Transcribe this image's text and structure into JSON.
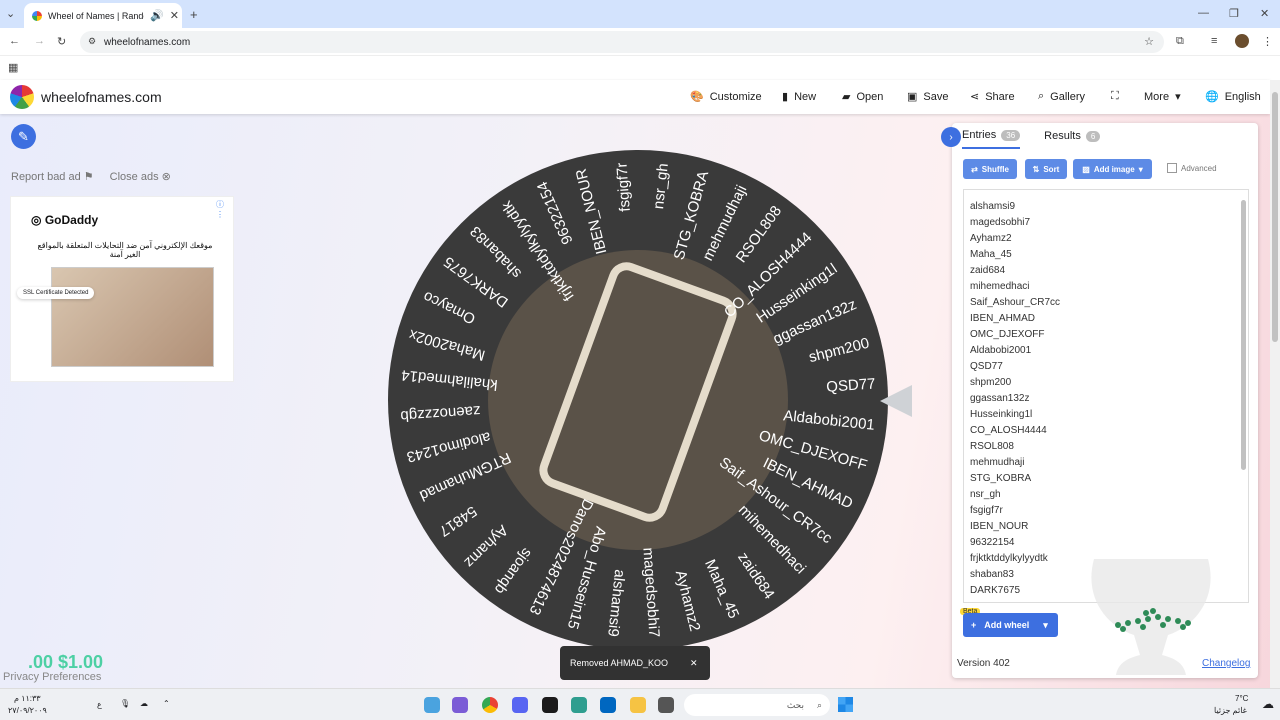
{
  "browser": {
    "tab_title": "Wheel of Names | Random",
    "url": "wheelofnames.com"
  },
  "site": {
    "brand": "wheelofnames.com",
    "nav": [
      {
        "icon": "palette-icon",
        "label": "Customize"
      },
      {
        "icon": "file-icon",
        "label": "New"
      },
      {
        "icon": "folder-open-icon",
        "label": "Open"
      },
      {
        "icon": "save-icon",
        "label": "Save"
      },
      {
        "icon": "share-icon",
        "label": "Share"
      },
      {
        "icon": "search-icon",
        "label": "Gallery"
      },
      {
        "icon": "fullscreen-icon",
        "label": ""
      },
      {
        "icon": "chevron-down-icon",
        "label": "More"
      },
      {
        "icon": "globe-icon",
        "label": "English"
      }
    ],
    "ad_links": {
      "report": "Report bad ad",
      "close": "Close ads"
    },
    "ad": {
      "brand": "GoDaddy",
      "text": "موقعك الإلكتروني آمن ضد التحايلات المتعلقة بالمواقع الغير آمنة",
      "ssl": "SSL Certificate Detected"
    },
    "price_ticker": ".00 $1.00",
    "privacy": "Privacy Preferences"
  },
  "wheel": {
    "entries": [
      "QSD77",
      "shpm200",
      "ggassan132z",
      "Husseinking1l",
      "CO_ALOSH4444",
      "RSOL808",
      "mehmudhaji",
      "STG_KOBRA",
      "nsr_gh",
      "fsgigf7r",
      "IBEN_NOUR",
      "96322154",
      "frjktktddylkylyydtk",
      "shaban83",
      "DARK7675",
      "Omayco",
      "Maha2002x",
      "khalilahmed14",
      "zaenozzzgb",
      "alodimo1243",
      "RTGMuhamad",
      "54817",
      "Ayhamz",
      "sjoanqb",
      "Danos2024874613",
      "Abo_Hussein15",
      "alshamsi9",
      "magedsobhi7",
      "Ayhamz2",
      "Maha_45",
      "zaid684",
      "mihemedhaci",
      "Saif_Ashour_CR7cc",
      "IBEN_AHMAD",
      "OMC_DJEXOFF",
      "Aldabobi2001"
    ]
  },
  "panel": {
    "tab_entries": "Entries",
    "entries_count": "36",
    "tab_results": "Results",
    "results_count": "6",
    "shuffle": "Shuffle",
    "sort": "Sort",
    "add_image": "Add image",
    "advanced": "Advanced",
    "entries_visible": [
      "alshamsi9",
      "magedsobhi7",
      "Ayhamz2",
      "Maha_45",
      "zaid684",
      "mihemedhaci",
      "Saif_Ashour_CR7cc",
      "IBEN_AHMAD",
      "OMC_DJEXOFF",
      "Aldabobi2001",
      "QSD77",
      "shpm200",
      "ggassan132z",
      "Husseinking1l",
      "CO_ALOSH4444",
      "RSOL808",
      "mehmudhaji",
      "STG_KOBRA",
      "nsr_gh",
      "fsgigf7r",
      "IBEN_NOUR",
      "96322154",
      "frjktktddylkylyydtk",
      "shaban83",
      "DARK7675"
    ],
    "beta": "Beta",
    "add_wheel": "Add wheel",
    "version": "Version 402",
    "changelog": "Changelog"
  },
  "toast": {
    "message": "Removed AHMAD_KOO"
  },
  "taskbar": {
    "time": "١١:٣٣ م",
    "date": "٢٧/٠٩/٢٠٠٩",
    "lang": "ع",
    "search_placeholder": "بحث",
    "weather_temp": "7°C",
    "weather_text": "غائم جزئيا"
  }
}
